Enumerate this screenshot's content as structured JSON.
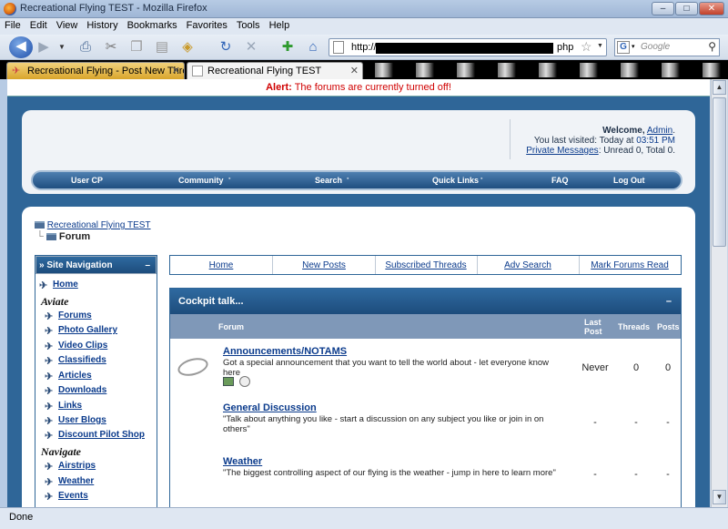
{
  "window": {
    "title": "Recreational Flying TEST - Mozilla Firefox",
    "min": "–",
    "max": "□",
    "close": "✕"
  },
  "menu": [
    "File",
    "Edit",
    "View",
    "History",
    "Bookmarks",
    "Favorites",
    "Tools",
    "Help"
  ],
  "address": {
    "prefix": "http://www.",
    "suffix": "php"
  },
  "search": {
    "placeholder": "Google"
  },
  "tabs": [
    {
      "label": "Recreational Flying - Post New Thre...",
      "close": "✕"
    },
    {
      "label": "Recreational Flying TEST",
      "close": "✕"
    }
  ],
  "alert": {
    "label": "Alert:",
    "text": "The forums are currently turned off!"
  },
  "welcome": {
    "greeting": "Welcome,",
    "user": "Admin",
    "period": ".",
    "last_visited_label": "You last visited: Today at",
    "last_visited_time": "03:51 PM",
    "pm_link": "Private Messages",
    "pm_text": ": Unread 0, Total 0."
  },
  "mainnav": [
    "User CP",
    "Community",
    "Search",
    "Quick Links",
    "FAQ",
    "Log Out"
  ],
  "breadcrumb": {
    "site": "Recreational Flying TEST",
    "current": "Forum"
  },
  "sidebar": {
    "title": "» Site Navigation",
    "collapse": "–",
    "home": "Home",
    "sections": [
      {
        "heading": "Aviate",
        "items": [
          "Forums",
          "Photo Gallery",
          "Video Clips",
          "Classifieds",
          "Articles",
          "Downloads",
          "Links",
          "User Blogs",
          "Discount Pilot Shop"
        ]
      },
      {
        "heading": "Navigate",
        "items": [
          "Airstrips",
          "Weather",
          "Events"
        ]
      }
    ]
  },
  "quicklinks": [
    "Home",
    "New Posts",
    "Subscribed Threads",
    "Adv Search",
    "Mark Forums Read"
  ],
  "category": {
    "title": "Cockpit talk...",
    "collapse": "–",
    "columns": {
      "forum": "Forum",
      "last_post": "Last Post",
      "threads": "Threads",
      "posts": "Posts"
    },
    "forums": [
      {
        "title": "Announcements/NOTAMS",
        "desc": "Got a special announcement that you want to tell the world about - let everyone know here",
        "last_post": "Never",
        "threads": "0",
        "posts": "0"
      },
      {
        "title": "General Discussion",
        "desc": "\"Talk about anything you like - start a discussion on any subject you like or join in on others\"",
        "last_post": "-",
        "threads": "-",
        "posts": "-"
      },
      {
        "title": "Weather",
        "desc": "\"The biggest controlling aspect of our flying is the weather - jump in here to learn more\"",
        "last_post": "-",
        "threads": "-",
        "posts": "-"
      }
    ]
  },
  "status": {
    "text": "Done"
  }
}
